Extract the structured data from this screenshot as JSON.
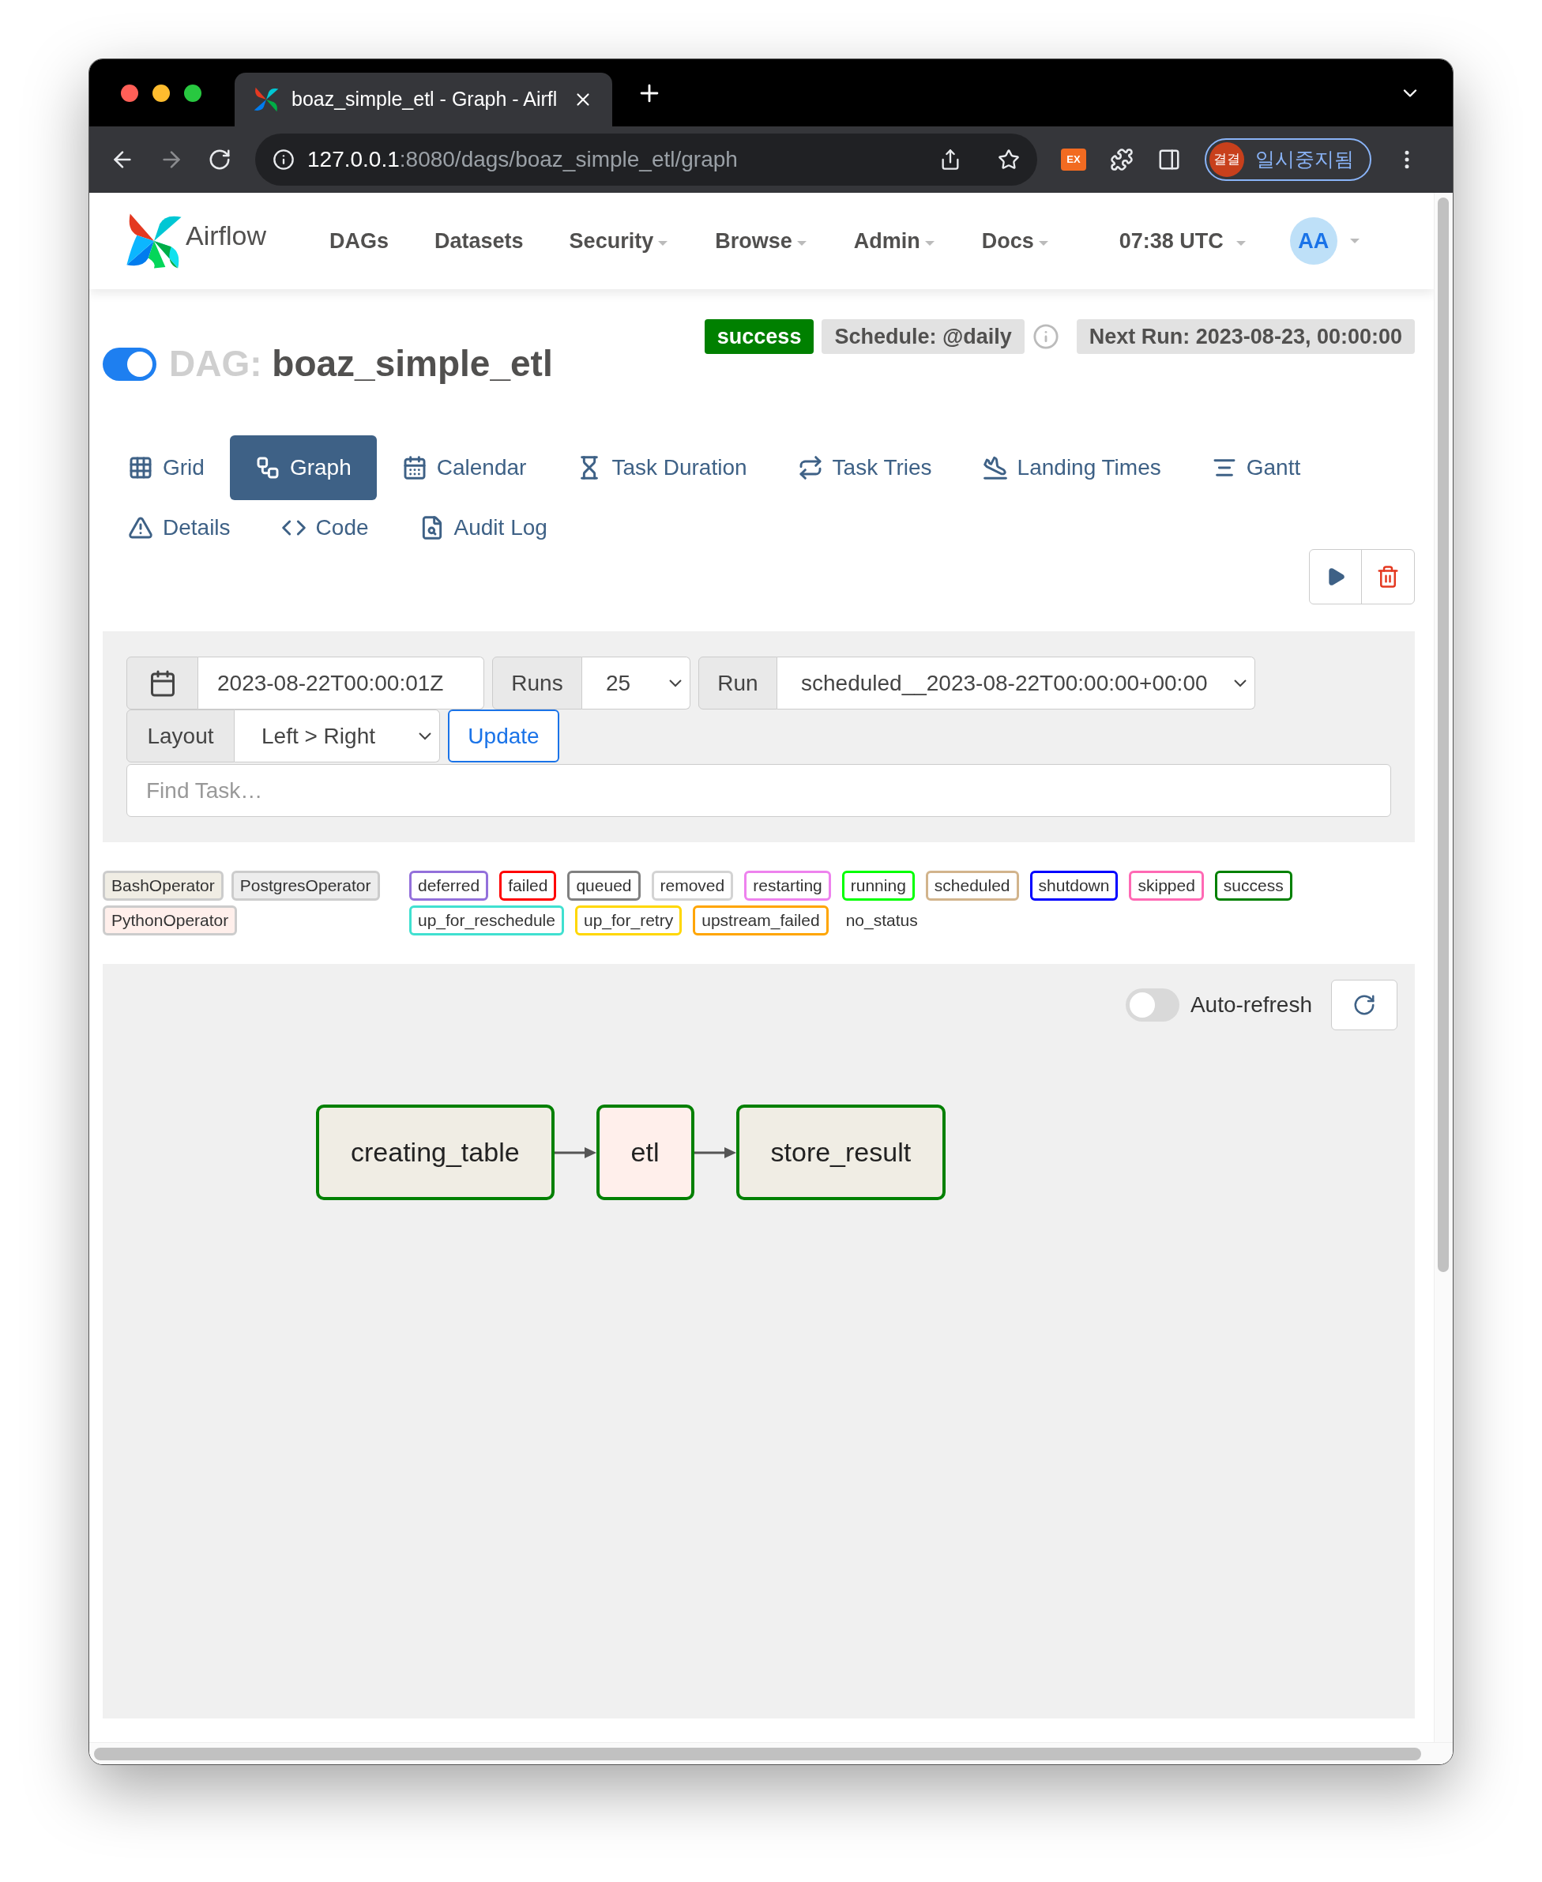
{
  "browser": {
    "tab_title": "boaz_simple_etl - Graph - Airfl",
    "url_host": "127.0.0.1",
    "url_path": ":8080/dags/boaz_simple_etl/graph",
    "extension": "EX",
    "profile_avatar": "결결",
    "profile_label": "일시중지됨"
  },
  "nav": {
    "brand": "Airflow",
    "items": [
      {
        "label": "DAGs",
        "dropdown": false
      },
      {
        "label": "Datasets",
        "dropdown": false
      },
      {
        "label": "Security",
        "dropdown": true
      },
      {
        "label": "Browse",
        "dropdown": true
      },
      {
        "label": "Admin",
        "dropdown": true
      },
      {
        "label": "Docs",
        "dropdown": true
      }
    ],
    "time": "07:38 UTC",
    "user": "AA"
  },
  "dag": {
    "on": true,
    "prefix": "DAG:",
    "name": "boaz_simple_etl",
    "status": {
      "label": "success",
      "color": "#008000"
    },
    "schedule": "Schedule: @daily",
    "next_run": "Next Run: 2023-08-23, 00:00:00"
  },
  "view_tabs": [
    {
      "kind": "grid",
      "label": "Grid",
      "selected": false
    },
    {
      "kind": "graph",
      "label": "Graph",
      "selected": true
    },
    {
      "kind": "calendar",
      "label": "Calendar",
      "selected": false
    },
    {
      "kind": "duration",
      "label": "Task Duration",
      "selected": false
    },
    {
      "kind": "tries",
      "label": "Task Tries",
      "selected": false
    },
    {
      "kind": "landing",
      "label": "Landing Times",
      "selected": false
    },
    {
      "kind": "gantt",
      "label": "Gantt",
      "selected": false
    },
    {
      "kind": "details",
      "label": "Details",
      "selected": false
    },
    {
      "kind": "code",
      "label": "Code",
      "selected": false
    },
    {
      "kind": "audit",
      "label": "Audit Log",
      "selected": false
    }
  ],
  "controls": {
    "base_date": "2023-08-22T00:00:01Z",
    "runs_label": "Runs",
    "runs_value": "25",
    "run_label": "Run",
    "run_value": "scheduled__2023-08-22T00:00:00+00:00",
    "layout_label": "Layout",
    "layout_value": "Left > Right",
    "update": "Update",
    "find_placeholder": "Find Task…"
  },
  "operators": [
    {
      "label": "BashOperator",
      "color": "#f0ede4"
    },
    {
      "label": "PostgresOperator",
      "color": "#ededed"
    },
    {
      "label": "PythonOperator",
      "color": "#ffefeb"
    }
  ],
  "states": [
    {
      "label": "deferred",
      "color": "#9370db"
    },
    {
      "label": "failed",
      "color": "#ff0000"
    },
    {
      "label": "queued",
      "color": "#808080"
    },
    {
      "label": "removed",
      "color": "#d3d3d3"
    },
    {
      "label": "restarting",
      "color": "#ee82ee"
    },
    {
      "label": "running",
      "color": "#00ff00"
    },
    {
      "label": "scheduled",
      "color": "#d2b48c"
    },
    {
      "label": "shutdown",
      "color": "#0000ff"
    },
    {
      "label": "skipped",
      "color": "#ff69b4"
    },
    {
      "label": "success",
      "color": "#008000"
    },
    {
      "label": "up_for_reschedule",
      "color": "#40e0d0"
    },
    {
      "label": "up_for_retry",
      "color": "#ffd700"
    },
    {
      "label": "upstream_failed",
      "color": "#ffa500"
    },
    {
      "label": "no_status"
    }
  ],
  "graph": {
    "auto_refresh": {
      "label": "Auto-refresh",
      "on": false
    },
    "nodes": [
      {
        "label": "creating_table",
        "color": "#f0ede4"
      },
      {
        "label": "etl",
        "color": "#ffefeb"
      },
      {
        "label": "store_result",
        "color": "#f0ede4"
      }
    ]
  }
}
